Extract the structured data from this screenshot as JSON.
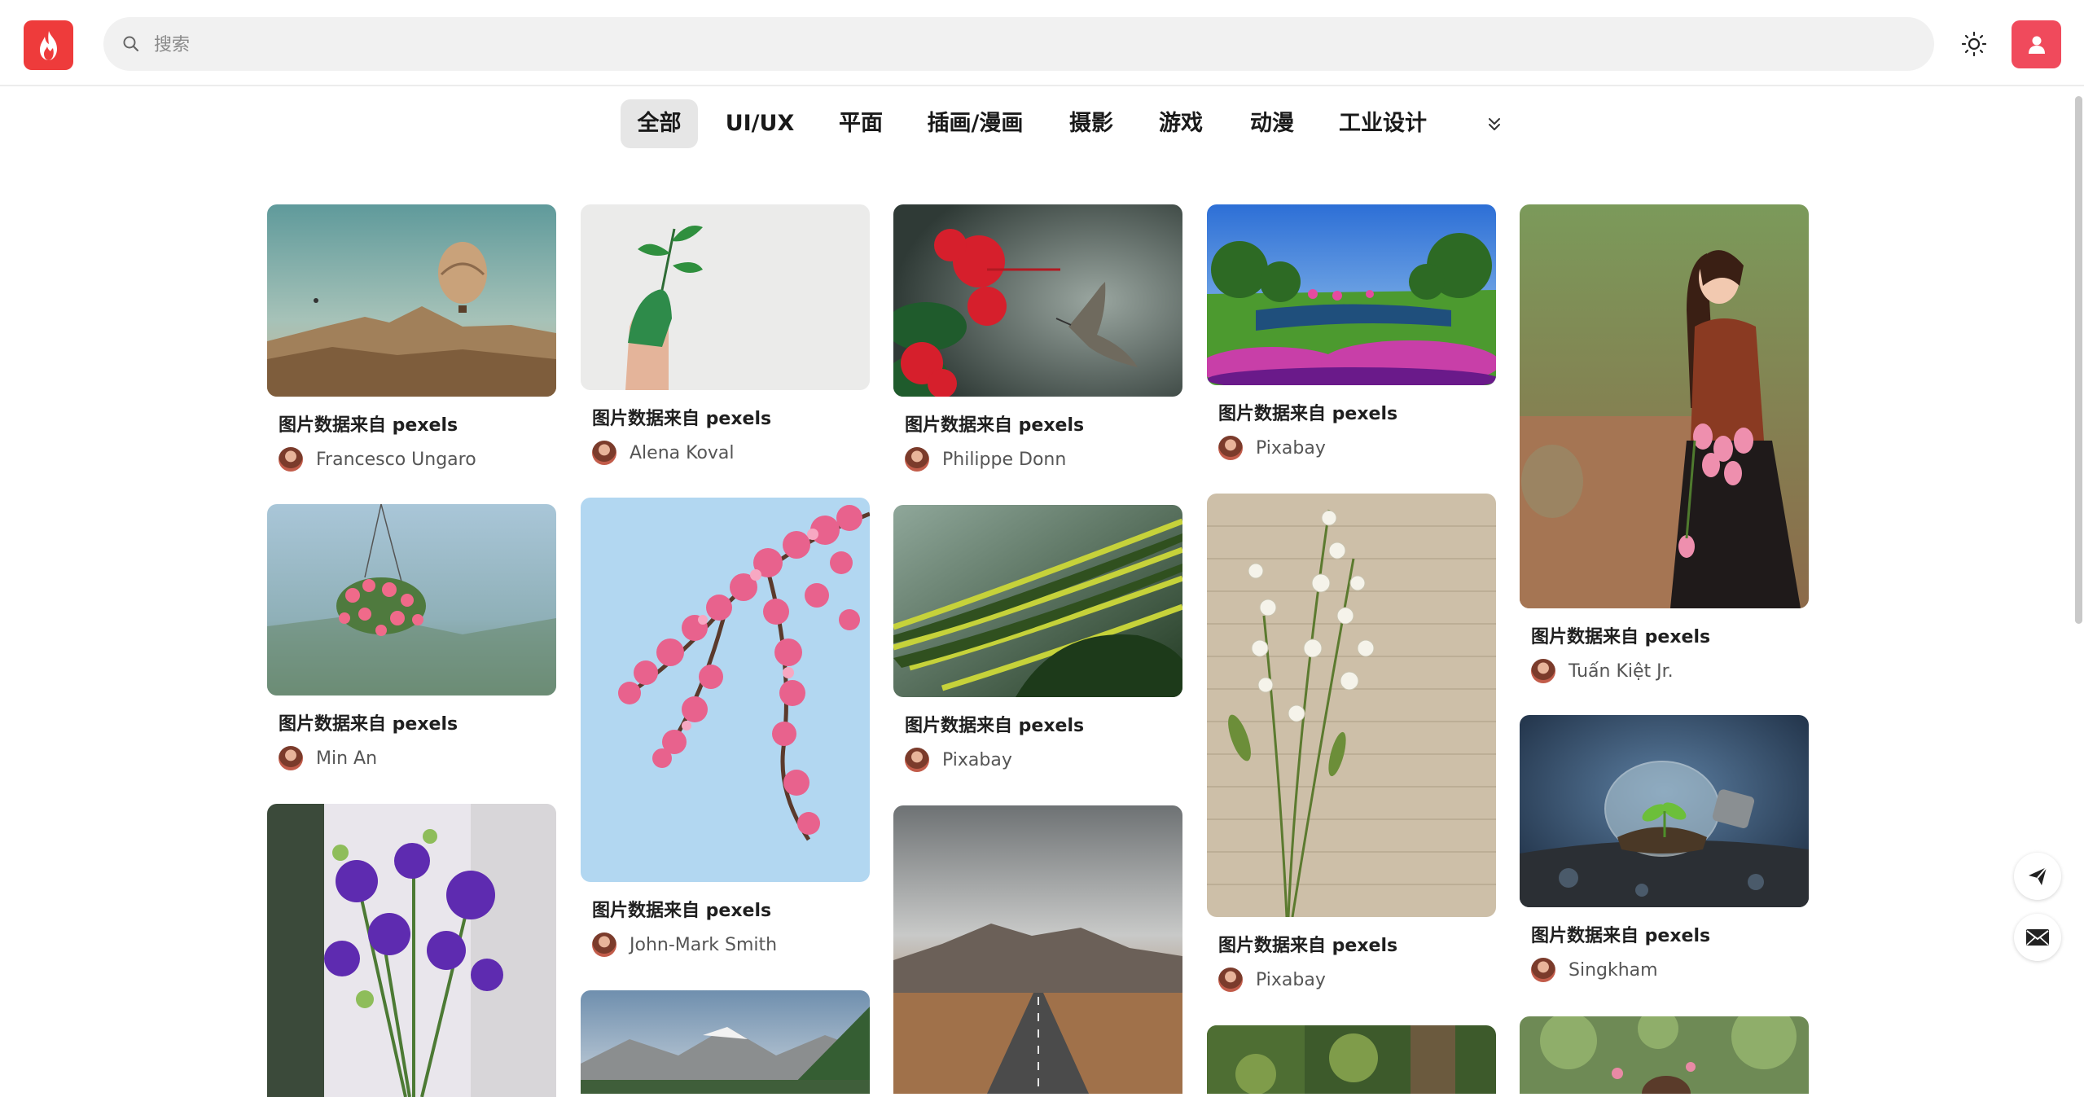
{
  "header": {
    "logo": "flame-icon",
    "search": {
      "placeholder": "搜索",
      "value": ""
    },
    "theme_icon": "sun-icon",
    "user_icon": "user-icon",
    "accent": "#ee3b3b"
  },
  "categories": {
    "items": [
      "全部",
      "UI/UX",
      "平面",
      "插画/漫画",
      "摄影",
      "游戏",
      "动漫",
      "工业设计"
    ],
    "active": "全部",
    "more_icon": "chevrons-down-icon"
  },
  "cards": [
    {
      "title": "图片数据来自 pexels",
      "author": "Francesco Ungaro",
      "image": "hot air balloon over desert hills"
    },
    {
      "title": "图片数据来自 pexels",
      "author": "Min An",
      "image": "hanging pink flower basket"
    },
    {
      "title": "",
      "author": "",
      "image": "purple roses in vase"
    },
    {
      "title": "图片数据来自 pexels",
      "author": "Alena Koval",
      "image": "green painted hand holding sprout"
    },
    {
      "title": "图片数据来自 pexels",
      "author": "John-Mark Smith",
      "image": "pink cherry blossom branch"
    },
    {
      "title": "",
      "author": "",
      "image": "mountain lake landscape"
    },
    {
      "title": "图片数据来自 pexels",
      "author": "Philippe Donn",
      "image": "red hibiscus with hummingbird"
    },
    {
      "title": "图片数据来自 pexels",
      "author": "Pixabay",
      "image": "rice terraces"
    },
    {
      "title": "",
      "author": "",
      "image": "road toward mountains"
    },
    {
      "title": "图片数据来自 pexels",
      "author": "Pixabay",
      "image": "park with river and flowers"
    },
    {
      "title": "图片数据来自 pexels",
      "author": "Pixabay",
      "image": "lily of the valley on paper"
    },
    {
      "title": "",
      "author": "",
      "image": "green forest"
    },
    {
      "title": "图片数据来自 pexels",
      "author": "Tuấn Kiệt Jr.",
      "image": "woman holding pink tulips"
    },
    {
      "title": "图片数据来自 pexels",
      "author": "Singkham",
      "image": "plant growing in light bulb"
    },
    {
      "title": "",
      "author": "",
      "image": "person among trees"
    }
  ],
  "floating": {
    "send_icon": "send-icon",
    "mail_icon": "mail-icon"
  }
}
